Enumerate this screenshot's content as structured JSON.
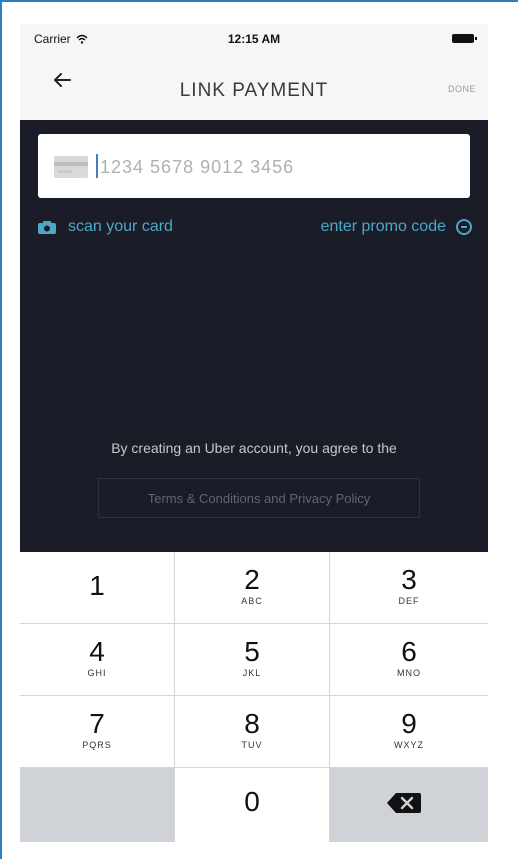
{
  "status_bar": {
    "carrier": "Carrier",
    "time": "12:15 AM"
  },
  "nav": {
    "title": "LINK PAYMENT",
    "done_label": "DONE",
    "back_icon": "arrow-left-icon"
  },
  "card_input": {
    "placeholder": "1234 5678 9012 3456",
    "icon": "credit-card-icon"
  },
  "links": {
    "scan_label": "scan your card",
    "scan_icon": "camera-icon",
    "promo_label": "enter promo code",
    "promo_icon": "circle-minus-icon"
  },
  "legal": {
    "agree_text": "By creating an Uber account, you agree to the",
    "terms_label": "Terms & Conditions and Privacy Policy"
  },
  "keypad": {
    "keys": [
      {
        "num": "1",
        "letters": ""
      },
      {
        "num": "2",
        "letters": "ABC"
      },
      {
        "num": "3",
        "letters": "DEF"
      },
      {
        "num": "4",
        "letters": "GHI"
      },
      {
        "num": "5",
        "letters": "JKL"
      },
      {
        "num": "6",
        "letters": "MNO"
      },
      {
        "num": "7",
        "letters": "PQRS"
      },
      {
        "num": "8",
        "letters": "TUV"
      },
      {
        "num": "9",
        "letters": "WXYZ"
      },
      {
        "num": "0",
        "letters": ""
      }
    ],
    "delete_icon": "backspace-icon"
  },
  "colors": {
    "dark_background": "#1a1d27",
    "accent": "#4aa8c8",
    "keypad_gray": "#cfd2d6"
  }
}
